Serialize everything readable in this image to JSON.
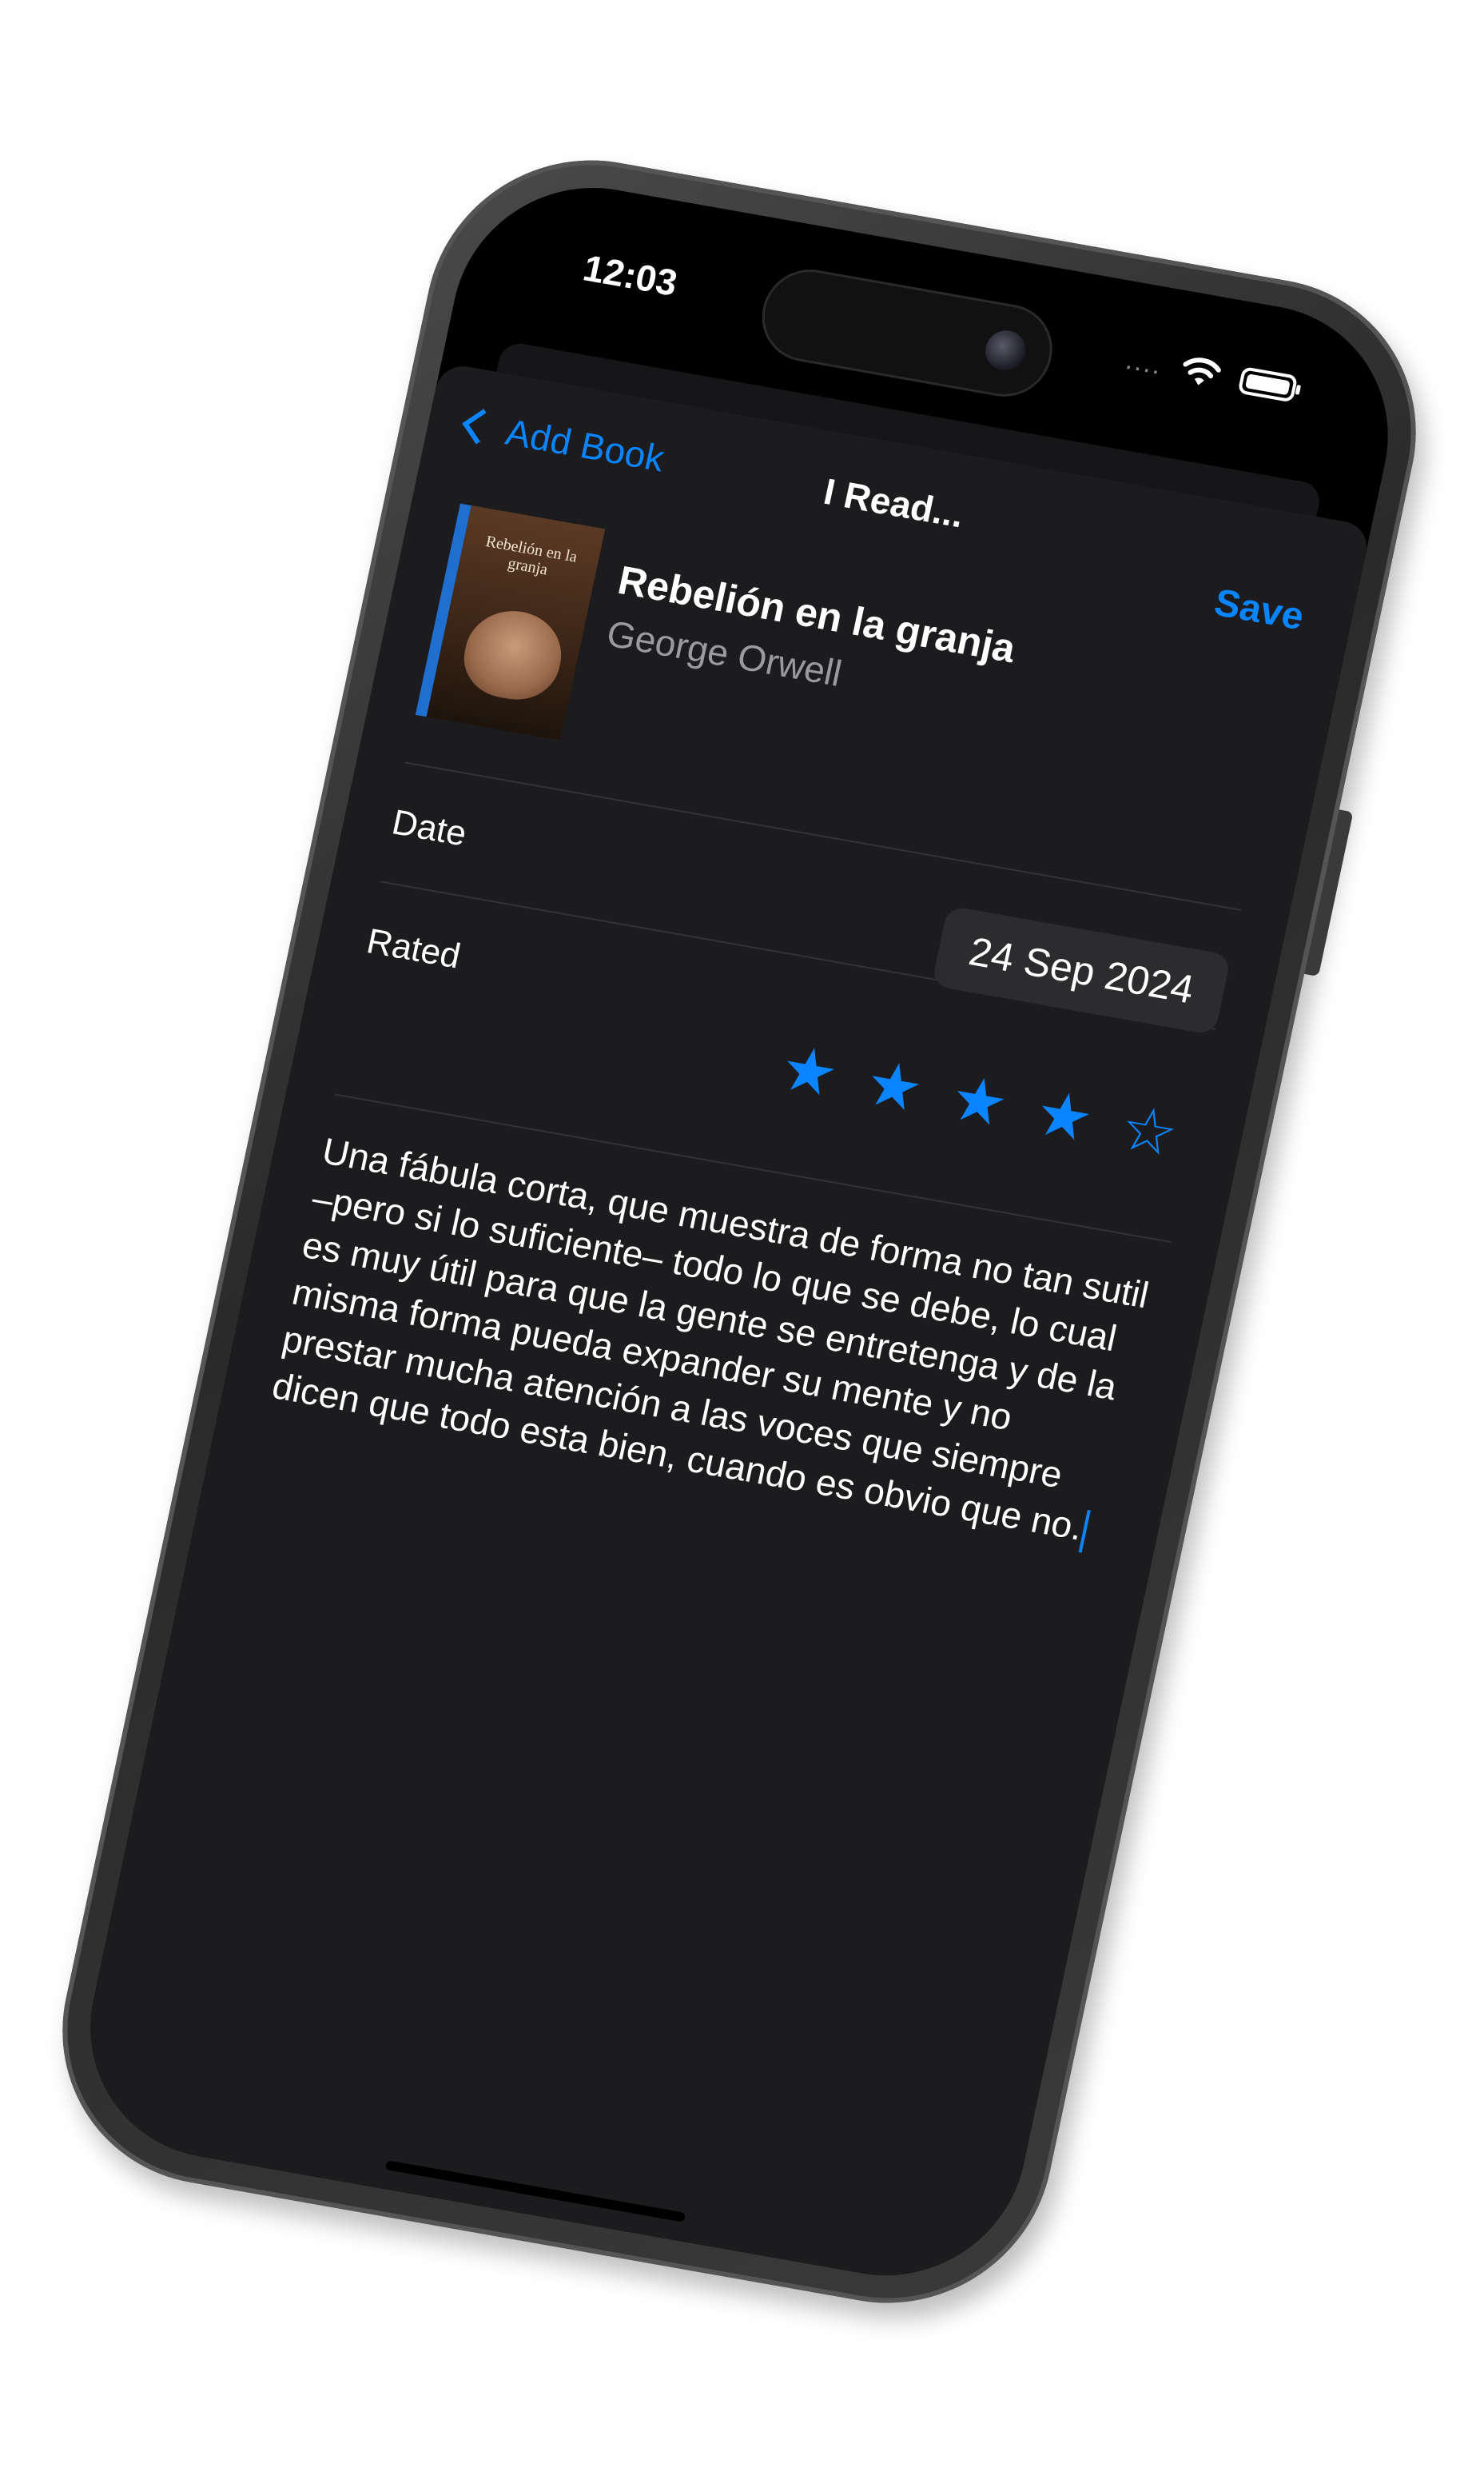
{
  "status_bar": {
    "time": "12:03",
    "signal": "....",
    "icons": [
      "wifi-icon",
      "battery-icon"
    ]
  },
  "nav": {
    "back_label": "Add Book",
    "title": "I Read...",
    "save_label": "Save"
  },
  "book": {
    "title": "Rebelión en la granja",
    "author": "George Orwell",
    "cover_title": "Rebelión en la granja"
  },
  "form": {
    "date_label": "Date",
    "date_value": "24 Sep 2024",
    "rated_label": "Rated",
    "rating": 4,
    "max_rating": 5
  },
  "review": {
    "text": "Una fábula corta, que muestra de forma no tan sutil –pero si lo suficiente– todo lo que se debe, lo cual es muy útil para que la gente se entretenga y de la misma forma pueda expander su mente y no prestar mucha atención a las voces que siempre dicen que todo esta bien, cuando es obvio que no."
  },
  "colors": {
    "accent": "#0a84ff",
    "sheet_bg": "#1c1c1e",
    "secondary_text": "#9a9aa0"
  }
}
